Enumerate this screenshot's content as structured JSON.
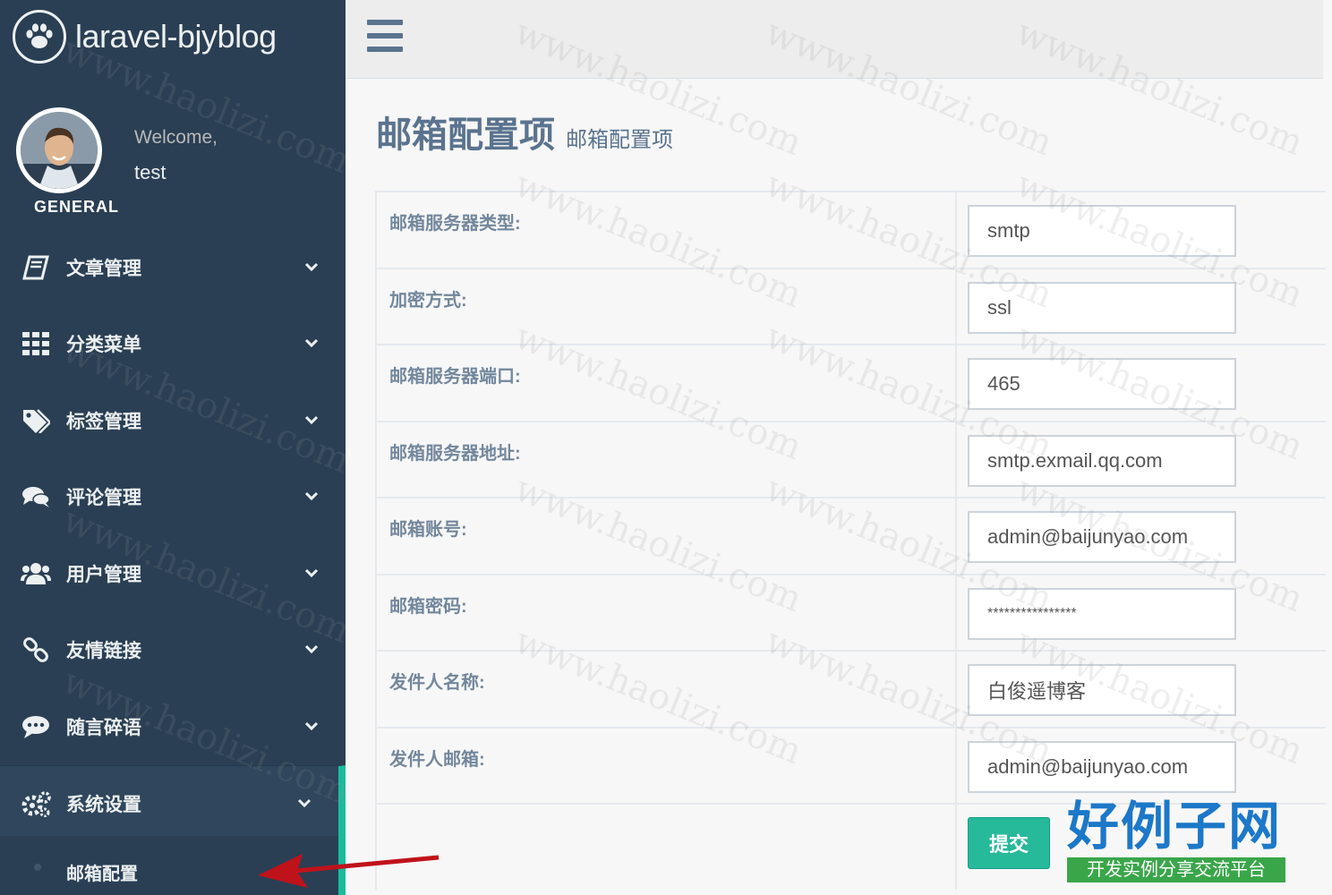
{
  "brand": {
    "title": "laravel-bjyblog",
    "icon": "paw-icon"
  },
  "profile": {
    "welcome": "Welcome,",
    "username": "test"
  },
  "sidebar": {
    "section_title": "GENERAL",
    "items": [
      {
        "label": "文章管理",
        "icon": "book-icon"
      },
      {
        "label": "分类菜单",
        "icon": "grid-icon"
      },
      {
        "label": "标签管理",
        "icon": "tags-icon"
      },
      {
        "label": "评论管理",
        "icon": "comments-icon"
      },
      {
        "label": "用户管理",
        "icon": "users-icon"
      },
      {
        "label": "友情链接",
        "icon": "link-icon"
      },
      {
        "label": "随言碎语",
        "icon": "chat-icon"
      },
      {
        "label": "系统设置",
        "icon": "cogs-icon"
      }
    ],
    "sub_items": [
      {
        "label": "邮箱配置"
      }
    ]
  },
  "page": {
    "title": "邮箱配置项",
    "subtitle": "邮箱配置项"
  },
  "form": {
    "rows": [
      {
        "label": "邮箱服务器类型:",
        "value": "smtp"
      },
      {
        "label": "加密方式:",
        "value": "ssl"
      },
      {
        "label": "邮箱服务器端口:",
        "value": "465"
      },
      {
        "label": "邮箱服务器地址:",
        "value": "smtp.exmail.qq.com"
      },
      {
        "label": "邮箱账号:",
        "value": "admin@baijunyao.com"
      },
      {
        "label": "邮箱密码:",
        "value": "****************"
      },
      {
        "label": "发件人名称:",
        "value": "白俊遥博客"
      },
      {
        "label": "发件人邮箱:",
        "value": "admin@baijunyao.com"
      }
    ],
    "submit_label": "提交"
  },
  "watermark": "www.haolizi.com",
  "stamp": {
    "title": "好例子网",
    "tagline": "开发实例分享交流平台"
  },
  "colors": {
    "sidebar": "#2a3f54",
    "accent": "#1abb9c",
    "button": "#26b99a",
    "arrow": "#c0121a"
  }
}
